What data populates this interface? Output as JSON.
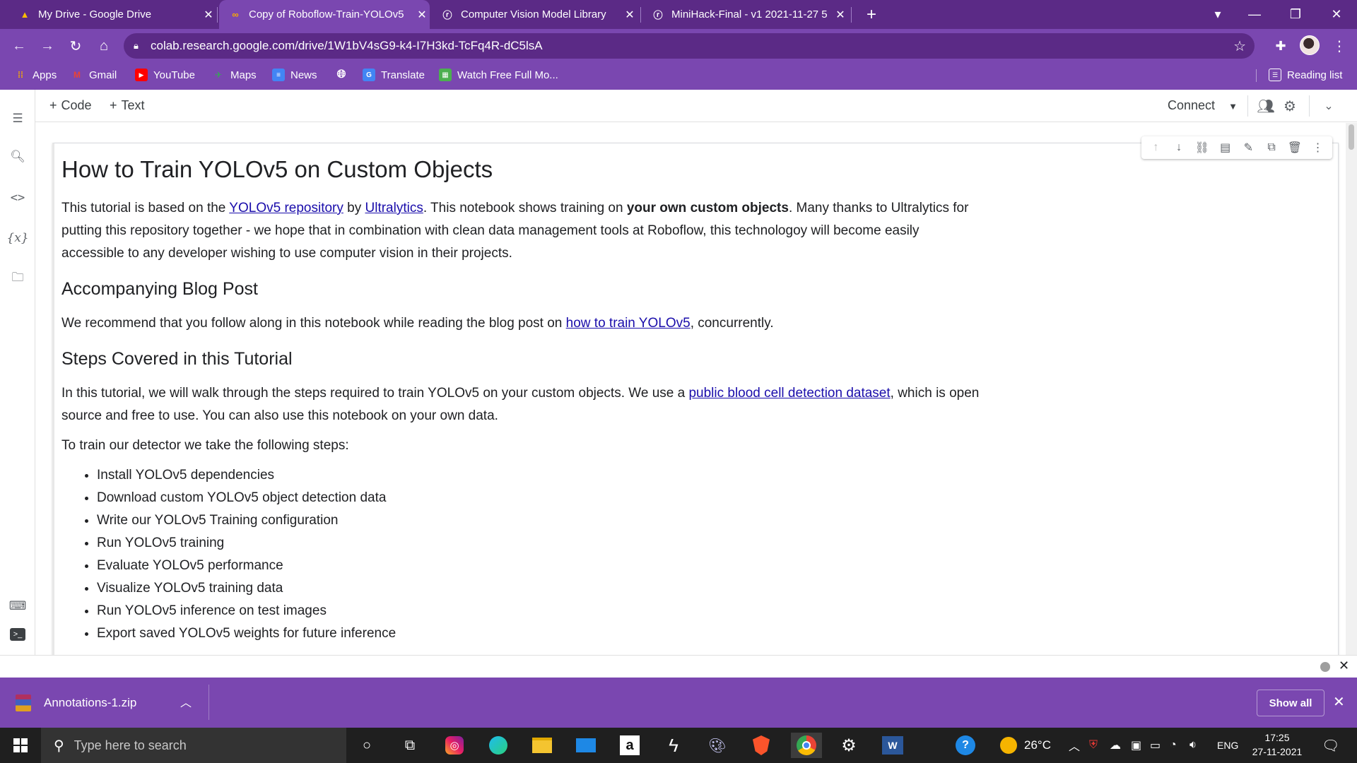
{
  "browser": {
    "tabs": [
      {
        "title": "My Drive - Google Drive",
        "icon": "google-drive-icon",
        "active": false
      },
      {
        "title": "Copy of Roboflow-Train-YOLOv5",
        "icon": "colab-icon",
        "active": true
      },
      {
        "title": "Computer Vision Model Library",
        "icon": "roboflow-icon",
        "active": false
      },
      {
        "title": "MiniHack-Final - v1 2021-11-27 5",
        "icon": "roboflow-icon",
        "active": false
      }
    ],
    "url": "colab.research.google.com/drive/1W1bV4sG9-k4-I7H3kd-TcFq4R-dC5lsA",
    "bookmarks": [
      "Apps",
      "Gmail",
      "YouTube",
      "Maps",
      "News",
      "",
      "Translate",
      "Watch Free Full Mo..."
    ],
    "reading_list": "Reading list"
  },
  "colab": {
    "add_code": "Code",
    "add_text": "Text",
    "connect": "Connect"
  },
  "notebook": {
    "h1": "How to Train YOLOv5 on Custom Objects",
    "intro": {
      "t1": "This tutorial is based on the ",
      "link1": "YOLOv5 repository",
      "t2": " by ",
      "link2": "Ultralytics",
      "t3": ". This notebook shows training on ",
      "bold": "your own custom objects",
      "t4": ". Many thanks to Ultralytics for putting this repository together - we hope that in combination with clean data management tools at Roboflow, this technologoy will become easily accessible to any developer wishing to use computer vision in their projects."
    },
    "h2_blog": "Accompanying Blog Post",
    "blog": {
      "t1": "We recommend that you follow along in this notebook while reading the blog post on ",
      "link": "how to train YOLOv5",
      "t2": ", concurrently."
    },
    "h2_steps": "Steps Covered in this Tutorial",
    "steps_intro": {
      "t1": "In this tutorial, we will walk through the steps required to train YOLOv5 on your custom objects. We use a ",
      "link": "public blood cell detection dataset",
      "t2": ", which is open source and free to use. You can also use this notebook on your own data."
    },
    "steps_lead": "To train our detector we take the following steps:",
    "steps": [
      "Install YOLOv5 dependencies",
      "Download custom YOLOv5 object detection data",
      "Write our YOLOv5 Training configuration",
      "Run YOLOv5 training",
      "Evaluate YOLOv5 performance",
      "Visualize YOLOv5 training data",
      "Run YOLOv5 inference on test images",
      "Export saved YOLOv5 weights for future inference"
    ]
  },
  "downloads": {
    "file": "Annotations-1.zip",
    "show_all": "Show all"
  },
  "taskbar": {
    "search_placeholder": "Type here to search",
    "temperature": "26°C",
    "language": "ENG",
    "time": "17:25",
    "date": "27-11-2021"
  }
}
